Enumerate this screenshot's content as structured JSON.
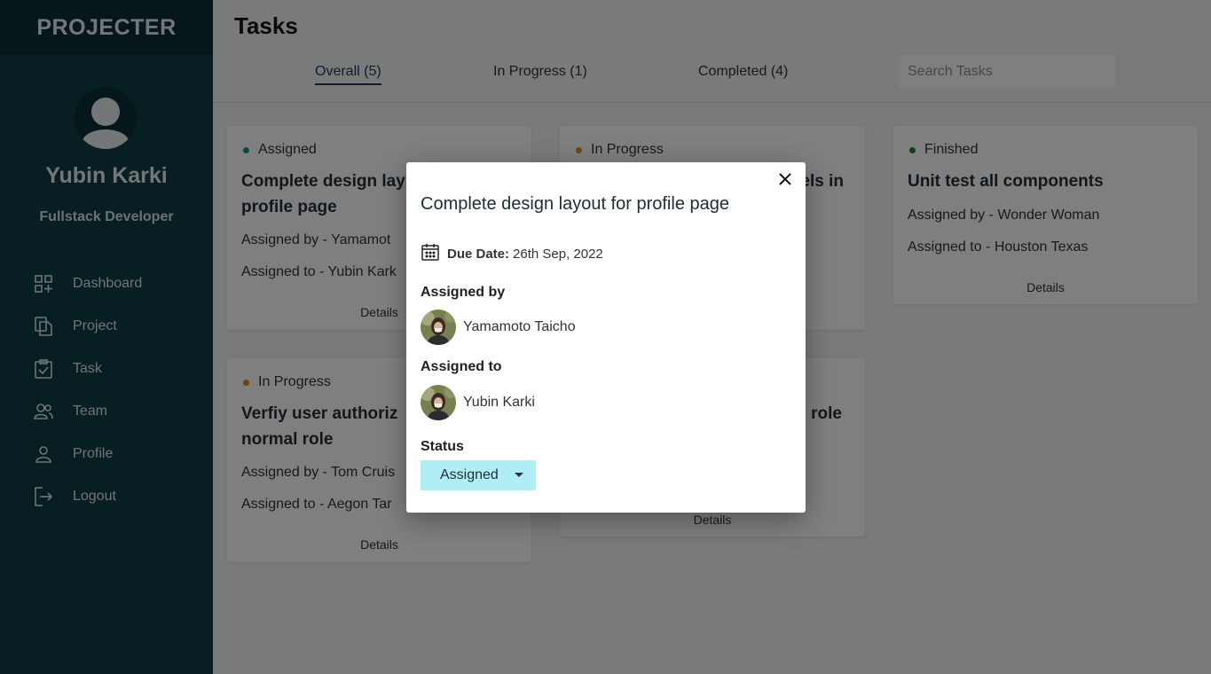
{
  "app": {
    "brand": "PROJECTER"
  },
  "user": {
    "name": "Yubin Karki",
    "role": "Fullstack Developer"
  },
  "sidebar": {
    "items": [
      {
        "label": "Dashboard",
        "icon": "dashboard-icon"
      },
      {
        "label": "Project",
        "icon": "files-icon"
      },
      {
        "label": "Task",
        "icon": "task-check-icon"
      },
      {
        "label": "Team",
        "icon": "team-icon"
      },
      {
        "label": "Profile",
        "icon": "person-icon"
      },
      {
        "label": "Logout",
        "icon": "logout-icon"
      }
    ]
  },
  "header": {
    "title": "Tasks"
  },
  "tabs": [
    {
      "label": "Overall (5)",
      "active": true
    },
    {
      "label": "In Progress (1)",
      "active": false
    },
    {
      "label": "Completed (4)",
      "active": false
    }
  ],
  "search": {
    "placeholder": "Search Tasks"
  },
  "cards": [
    {
      "status": "Assigned",
      "status_color": "#1a8a86",
      "title_line1": "Complete design lay",
      "title_line2": "profile page",
      "assigned_by": "Assigned by - Yamamot",
      "assigned_to": "Assigned to - Yubin Kark",
      "details": "Details"
    },
    {
      "status": "In Progress",
      "status_color": "#d98c1a",
      "title_line1": "els in",
      "details": "Details"
    },
    {
      "status": "Finished",
      "status_color": "#1a8a2e",
      "title_line1": "Unit test all components",
      "assigned_by": "Assigned by - Wonder Woman",
      "assigned_to": "Assigned to - Houston Texas",
      "details": "Details"
    },
    {
      "status": "In Progress",
      "status_color": "#d98c1a",
      "title_line1": "Verfiy user authoriz",
      "title_line2": "normal role",
      "assigned_by": "Assigned by - Tom Cruis",
      "assigned_to": "Assigned to - Aegon Tar",
      "details": "Details"
    },
    {
      "title_line1": "role",
      "details": "Details"
    }
  ],
  "modal": {
    "title": "Complete design layout for profile page",
    "due_label": "Due Date:",
    "due_value": "26th Sep, 2022",
    "assigned_by_label": "Assigned by",
    "assigned_by_name": "Yamamoto Taicho",
    "assigned_to_label": "Assigned to",
    "assigned_to_name": "Yubin Karki",
    "status_label": "Status",
    "status_value": "Assigned",
    "status_bg": "#aeeef4"
  }
}
